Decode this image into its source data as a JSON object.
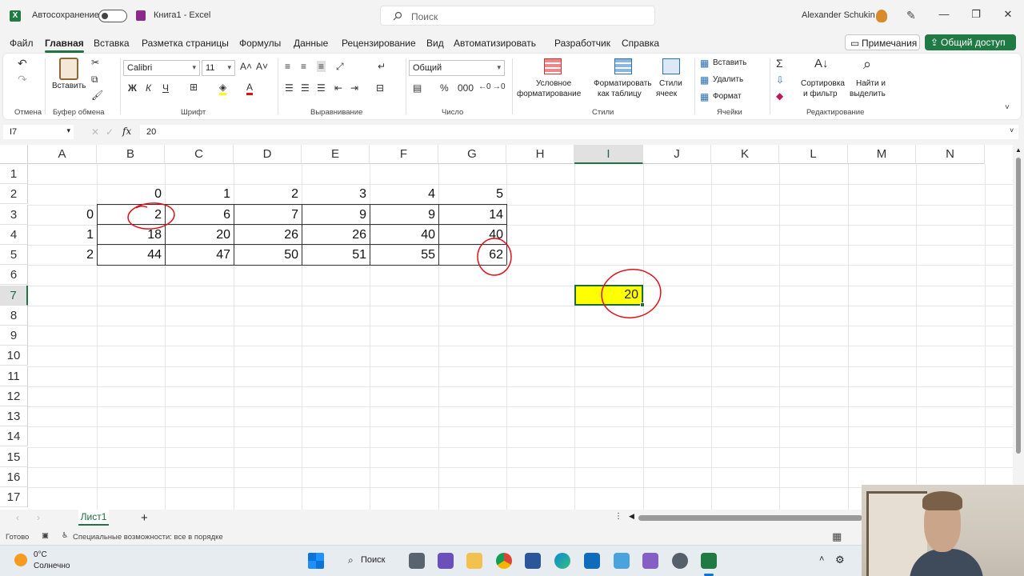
{
  "titlebar": {
    "autosave_label": "Автосохранение",
    "doc_title": "Книга1  -  Excel",
    "search_placeholder": "Поиск",
    "user_name": "Alexander Schukin"
  },
  "menu": {
    "items": [
      "Файл",
      "Главная",
      "Вставка",
      "Разметка страницы",
      "Формулы",
      "Данные",
      "Рецензирование",
      "Вид",
      "Автоматизировать",
      "Разработчик",
      "Справка"
    ],
    "active": "Главная",
    "comments_label": "Примечания",
    "share_label": "Общий доступ"
  },
  "ribbon": {
    "undo_group": "Отмена",
    "clipboard": {
      "paste_label": "Вставить",
      "group": "Буфер обмена"
    },
    "font": {
      "name": "Calibri",
      "size": "11",
      "bold": "Ж",
      "italic": "К",
      "underline": "Ч",
      "group": "Шрифт"
    },
    "alignment": {
      "group": "Выравнивание"
    },
    "number": {
      "format": "Общий",
      "group": "Число"
    },
    "styles": {
      "conditional_1": "Условное",
      "conditional_2": "форматирование",
      "format_table_1": "Форматировать",
      "format_table_2": "как таблицу",
      "cell_styles_1": "Стили",
      "cell_styles_2": "ячеек",
      "group": "Стили"
    },
    "cells": {
      "insert": "Вставить",
      "delete": "Удалить",
      "format": "Формат",
      "group": "Ячейки"
    },
    "editing": {
      "sort_1": "Сортировка",
      "sort_2": "и фильтр",
      "find_1": "Найти и",
      "find_2": "выделить",
      "group": "Редактирование"
    }
  },
  "formula_bar": {
    "name_box": "I7",
    "fx": "fx",
    "value": "20"
  },
  "columns": [
    "A",
    "B",
    "C",
    "D",
    "E",
    "F",
    "G",
    "H",
    "I",
    "J",
    "K",
    "L",
    "M",
    "N"
  ],
  "selected_column": "I",
  "rows": [
    "1",
    "2",
    "3",
    "4",
    "5",
    "6",
    "7",
    "8",
    "9",
    "10",
    "11",
    "12",
    "13",
    "14",
    "15",
    "16",
    "17"
  ],
  "selected_row": "7",
  "table": {
    "header_row": [
      "0",
      "1",
      "2",
      "3",
      "4",
      "5"
    ],
    "row_labels": [
      "0",
      "1",
      "2"
    ],
    "values": [
      [
        "2",
        "6",
        "7",
        "9",
        "9",
        "14"
      ],
      [
        "18",
        "20",
        "26",
        "26",
        "40",
        "40"
      ],
      [
        "44",
        "47",
        "50",
        "51",
        "55",
        "62"
      ]
    ]
  },
  "result_cell": {
    "value": "20",
    "fill": "#ffff00"
  },
  "annotation_color": "#e0101a",
  "sheet": {
    "tab": "Лист1",
    "add": "+"
  },
  "status": {
    "ready": "Готово",
    "accessibility": "Специальные возможности: все в порядке"
  },
  "weather": {
    "temp": "0°C",
    "desc": "Солнечно"
  },
  "taskbar": {
    "search": "Поиск"
  }
}
